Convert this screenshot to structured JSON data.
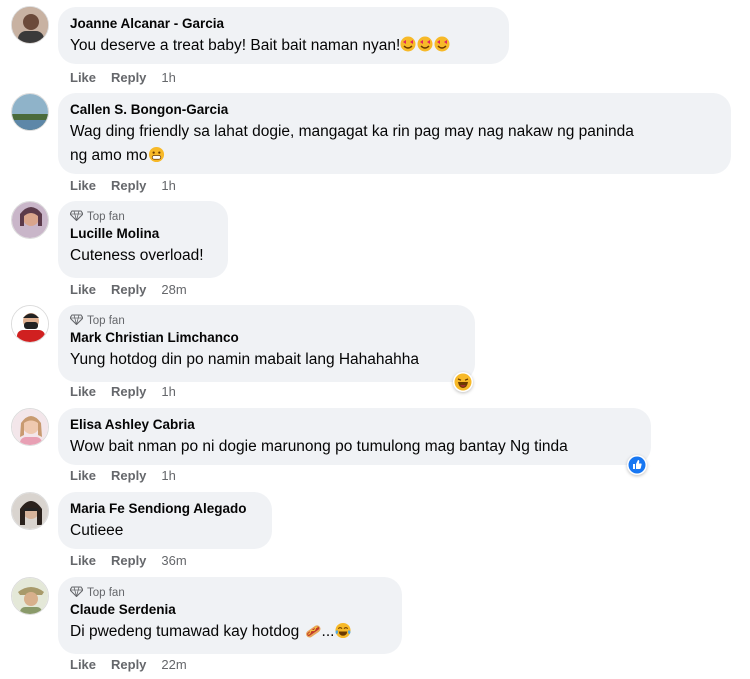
{
  "comments": [
    {
      "top_fan": "",
      "name": "Joanne Alcanar - Garcia",
      "text": "You deserve a treat baby! Bait bait naman nyan!",
      "time": "1h"
    },
    {
      "top_fan": "",
      "name": "Callen S. Bongon-Garcia",
      "text": "Wag ding friendly sa lahat dogie, mangagat ka rin pag may nag nakaw ng paninda",
      "text2": "ng amo mo",
      "time": "1h"
    },
    {
      "top_fan": "Top fan",
      "name": "Lucille Molina",
      "text": "Cuteness overload!",
      "time": "28m"
    },
    {
      "top_fan": "Top fan",
      "name": "Mark Christian Limchanco",
      "text": "Yung hotdog din po namin mabait lang Hahahahha",
      "time": "1h"
    },
    {
      "top_fan": "",
      "name": "Elisa Ashley Cabria",
      "text": "Wow bait nman po ni dogie marunong po tumulong mag bantay Ng tinda",
      "time": "1h"
    },
    {
      "top_fan": "",
      "name": "Maria Fe Sendiong Alegado",
      "text": "Cutieee",
      "time": "36m"
    },
    {
      "top_fan": "Top fan",
      "name": "Claude Serdenia",
      "text": "Di pwedeng tumawad kay hotdog",
      "text_suffix": "...",
      "time": "22m"
    }
  ],
  "actions": {
    "like": "Like",
    "reply": "Reply"
  },
  "icons": {
    "top_fan": "diamond-icon",
    "hearts_emoji": "smiling-face-with-hearts-emoji",
    "grin_emoji": "grinning-face-emoji",
    "laugh_reaction": "haha-reaction-icon",
    "like_reaction": "like-reaction-icon",
    "hotdog_emoji": "hotdog-emoji",
    "tears_emoji": "tears-of-joy-emoji"
  },
  "colors": {
    "bubble": "#f0f2f5",
    "meta": "#65676b",
    "like_blue": "#1877f2",
    "haha_yellow": "#f7b928"
  }
}
